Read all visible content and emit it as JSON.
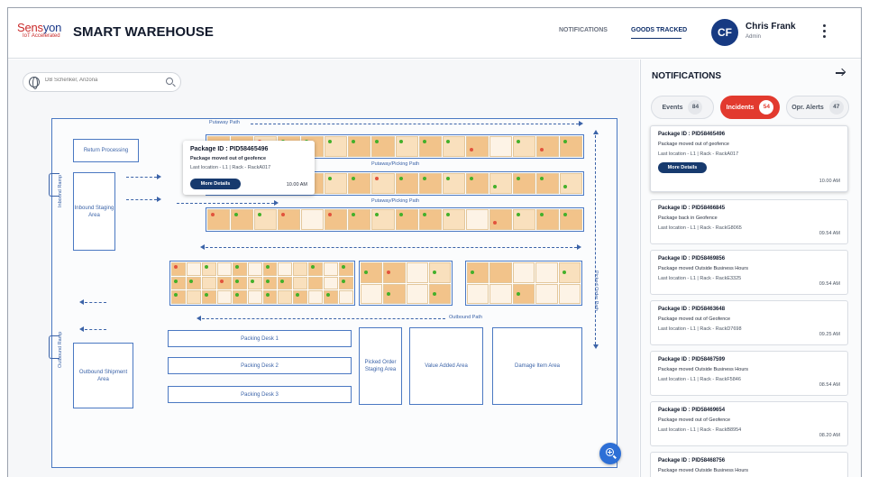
{
  "brand": {
    "name_part1": "Sens",
    "name_part2": "yon",
    "sub": "IoT Accelerated"
  },
  "app_title": "SMART WAREHOUSE",
  "nav": {
    "notifications": "NOTIFICATIONS",
    "goods_tracked": "GOODS TRACKED"
  },
  "user": {
    "initials": "CF",
    "name": "Chris Frank",
    "role": "Admin"
  },
  "search": {
    "placeholder": "DB Schenker, Arizona"
  },
  "map": {
    "labels": {
      "return_processing": "Return Processing",
      "inbound_staging": "Inbound Staging Area",
      "inbound_ramp": "Inbound Ramp",
      "outbound_ramp": "Outbound Ramp",
      "outbound_shipment": "Outbound Shipment Area",
      "putaway_path": "Putaway Path",
      "putaway_picking_1": "Putaway/Picking Path",
      "putaway_picking_2": "Putaway/Picking Path",
      "picked_order_path": "Picked Order Path",
      "outbound_path": "Outbound Path",
      "packing_desk_1": "Packing Desk 1",
      "packing_desk_2": "Packing Desk 2",
      "packing_desk_3": "Packing Desk 3",
      "picked_order_staging": "Picked Order Staging Area",
      "value_added": "Value Added Area",
      "damage_item": "Damage Item Area"
    },
    "popup": {
      "package_id": "Package ID : PID58465496",
      "message": "Package moved out of geofence",
      "location": "Last location - L1 |  Rack - RackA017",
      "button": "More Details",
      "time": "10.00 AM"
    }
  },
  "notifications": {
    "title": "NOTIFICATIONS",
    "tabs": [
      {
        "label": "Events",
        "count": "84"
      },
      {
        "label": "Incidents",
        "count": "54"
      },
      {
        "label": "Opr. Alerts",
        "count": "47"
      }
    ],
    "active_tab": "Incidents",
    "items": [
      {
        "package_id": "Package ID : PID58465496",
        "message": "Package moved out of geofence",
        "location": "Last location - L1 |  Rack - RackA017",
        "button": "More Details",
        "time": "10.00 AM"
      },
      {
        "package_id": "Package ID : PID58466845",
        "message": "Package back in Geofence",
        "location": "Last location - L1 |  Rack - RackG8065",
        "time": "09.54 AM"
      },
      {
        "package_id": "Package ID : PID58469856",
        "message": "Package moved Outside Business Hours",
        "location": "Last location - L1 |  Rack - RackE3325",
        "time": "09.54 AM"
      },
      {
        "package_id": "Package ID : PID58463648",
        "message": "Package moved out of Geofence",
        "location": "Last location - L1 |  Rack - RackD7698",
        "time": "09.25 AM"
      },
      {
        "package_id": "Package ID : PID58467599",
        "message": "Package moved Outside Business Hours",
        "location": "Last location - L1 |  Rack - RackF5846",
        "time": "08.54 AM"
      },
      {
        "package_id": "Package ID : PID58469654",
        "message": "Package moved out of Geofence",
        "location": "Last location - L1 |  Rack - RackB8954",
        "time": "08.20 AM"
      },
      {
        "package_id": "Package ID : PID58468756",
        "message": "Package moved Outside Business Hours"
      }
    ]
  },
  "colors": {
    "primary": "#173a82",
    "incident": "#e23a2e",
    "map_line": "#4a78c2",
    "occupied": "#f2c38a",
    "ok_dot": "#43b02a",
    "alert_dot": "#e2533d"
  }
}
